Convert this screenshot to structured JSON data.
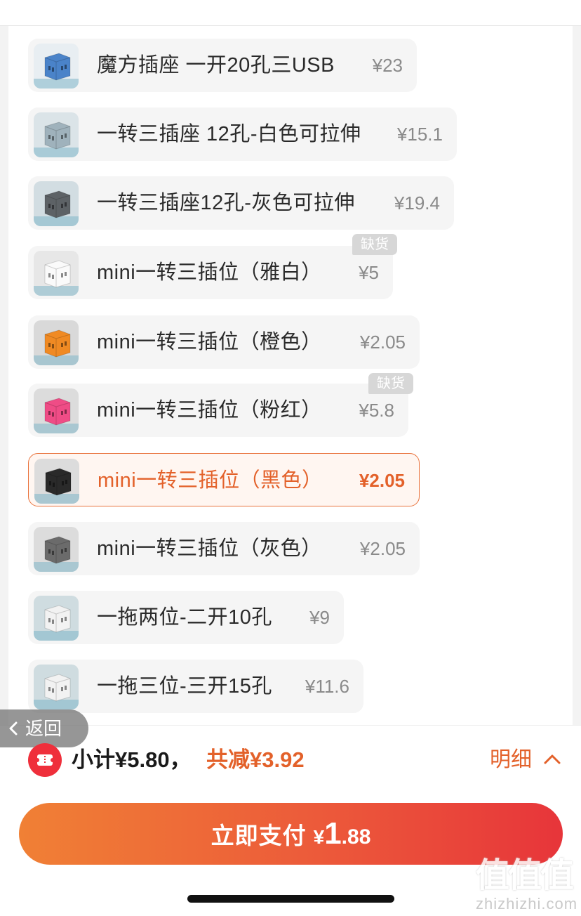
{
  "sku_list": [
    {
      "name": "魔方插座 一开20孔三USB",
      "price": "¥23",
      "colors": [
        "#e8eef2",
        "#4a83c9"
      ]
    },
    {
      "name": "一转三插座 12孔-白色可拉伸",
      "price": "¥15.1",
      "colors": [
        "#dbe4e8",
        "#9fb2bc"
      ]
    },
    {
      "name": "一转三插座12孔-灰色可拉伸",
      "price": "¥19.4",
      "colors": [
        "#d2dde2",
        "#5d6266"
      ]
    },
    {
      "name": "mini一转三插位（雅白）",
      "price": "¥5",
      "badge": "缺货",
      "colors": [
        "#e7e7e7",
        "#fafafa"
      ]
    },
    {
      "name": "mini一转三插位（橙色）",
      "price": "¥2.05",
      "colors": [
        "#d9d9d9",
        "#f08a23"
      ]
    },
    {
      "name": "mini一转三插位（粉红）",
      "price": "¥5.8",
      "badge": "缺货",
      "colors": [
        "#dcdcdc",
        "#ef4c86"
      ]
    },
    {
      "name": "mini一转三插位（黑色）",
      "price": "¥2.05",
      "selected": true,
      "colors": [
        "#dcdcdc",
        "#2a2a2a"
      ]
    },
    {
      "name": "mini一转三插位（灰色）",
      "price": "¥2.05",
      "colors": [
        "#dcdcdc",
        "#6b6b6b"
      ]
    },
    {
      "name": "一拖两位-二开10孔",
      "price": "¥9",
      "colors": [
        "#cfdce0",
        "#f2f2f2"
      ]
    },
    {
      "name": "一拖三位-三开15孔",
      "price": "¥11.6",
      "colors": [
        "#cfdce0",
        "#f2f2f2"
      ]
    }
  ],
  "back": {
    "label": "返回"
  },
  "summary": {
    "subtotal": "小计¥5.80，",
    "reduce": "共减¥3.92",
    "detail": "明细"
  },
  "pay": {
    "label": "立即支付",
    "currency": "¥",
    "int": "1",
    "dec": ".88"
  },
  "watermark": {
    "logo": "值值值",
    "url": "zhizhizhi.com"
  },
  "colors": {
    "accent": "#e3612a",
    "pay_start": "#f08035",
    "pay_end": "#e7353a",
    "badge": "#d7d7d7"
  }
}
